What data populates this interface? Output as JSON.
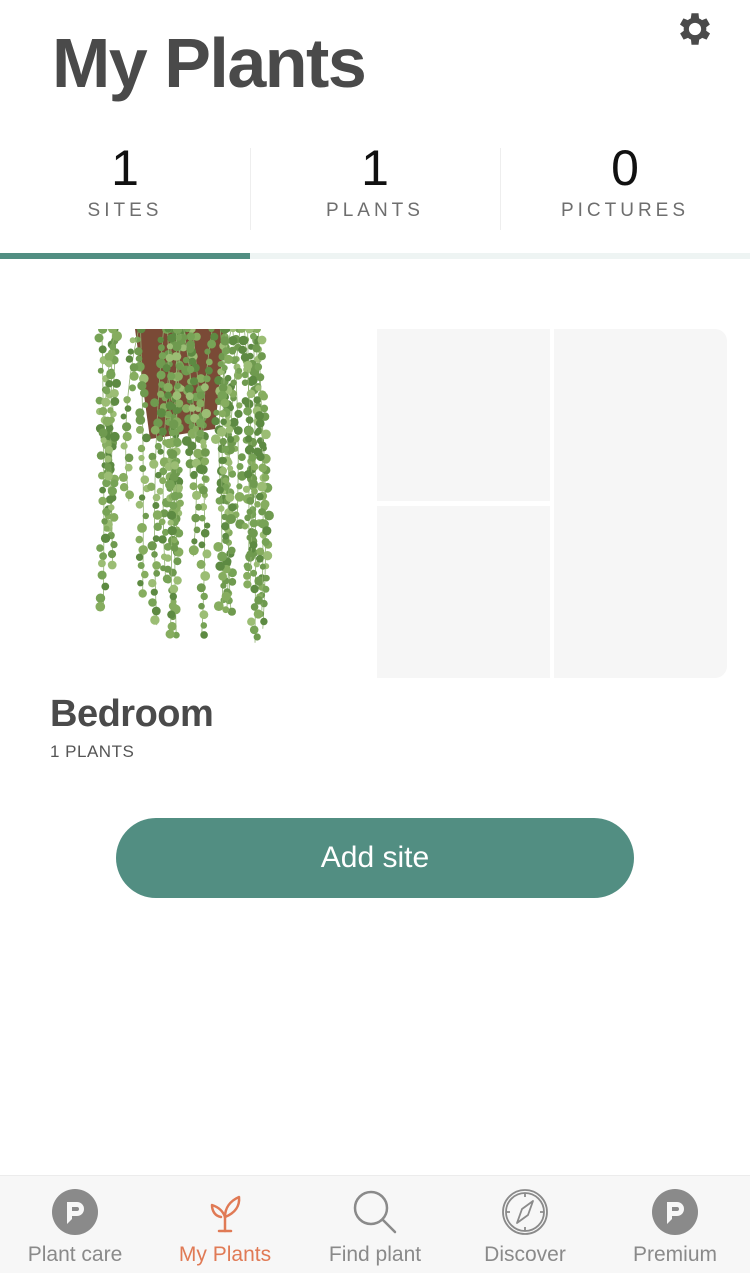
{
  "header": {
    "title": "My Plants",
    "settings_icon": "gear-icon"
  },
  "stats": [
    {
      "value": "1",
      "label": "SITES"
    },
    {
      "value": "1",
      "label": "PLANTS"
    },
    {
      "value": "0",
      "label": "PICTURES"
    }
  ],
  "active_stat_tab": 0,
  "colors": {
    "accent": "#528e82",
    "active_tab": "#e07a55",
    "inactive_tab": "#8a8a8a",
    "text": "#4a4a4a"
  },
  "sites": [
    {
      "name": "Bedroom",
      "count": "1 PLANTS",
      "image": "string-of-pearls-plant"
    }
  ],
  "add_site_label": "Add site",
  "tabbar": [
    {
      "label": "Plant care",
      "icon": "p-logo-icon",
      "active": false
    },
    {
      "label": "My Plants",
      "icon": "sprout-icon",
      "active": true
    },
    {
      "label": "Find plant",
      "icon": "search-icon",
      "active": false
    },
    {
      "label": "Discover",
      "icon": "compass-icon",
      "active": false
    },
    {
      "label": "Premium",
      "icon": "p-logo-icon",
      "active": false
    }
  ]
}
